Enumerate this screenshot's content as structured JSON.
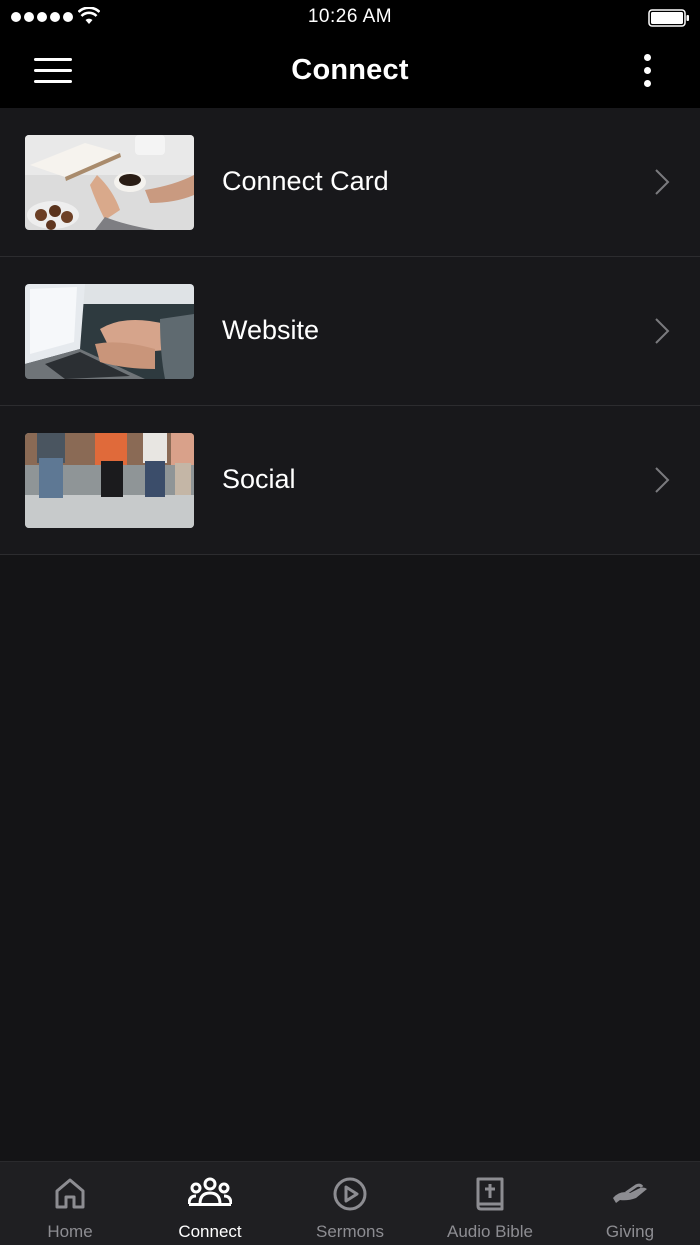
{
  "status": {
    "time": "10:26 AM"
  },
  "nav": {
    "title": "Connect"
  },
  "items": [
    {
      "label": "Connect Card",
      "image": "coffee-and-bible-photo"
    },
    {
      "label": "Website",
      "image": "laptop-typing-photo"
    },
    {
      "label": "Social",
      "image": "group-sitting-photo"
    }
  ],
  "tabs": [
    {
      "label": "Home",
      "icon": "home-icon",
      "active": false
    },
    {
      "label": "Connect",
      "icon": "people-icon",
      "active": true
    },
    {
      "label": "Sermons",
      "icon": "play-circle-icon",
      "active": false
    },
    {
      "label": "Audio Bible",
      "icon": "bible-icon",
      "active": false
    },
    {
      "label": "Giving",
      "icon": "giving-hand-icon",
      "active": false
    }
  ],
  "colors": {
    "background": "#141416",
    "bar": "#000000",
    "tab_inactive": "#8d8d92",
    "tab_active": "#ffffff"
  }
}
